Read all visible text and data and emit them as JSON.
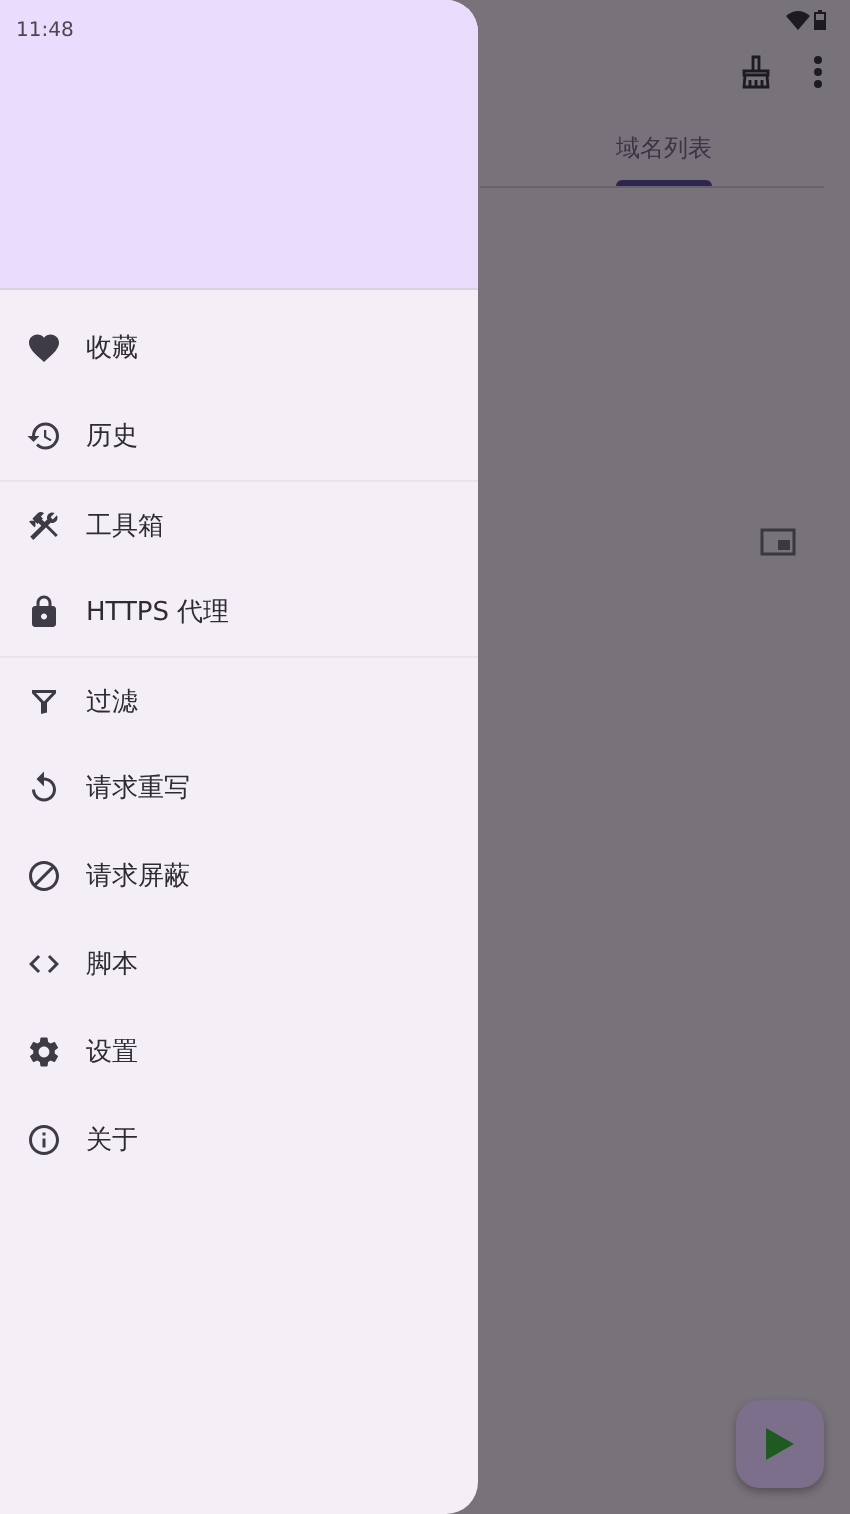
{
  "status_bar": {
    "time": "11:48"
  },
  "tabs": [
    {
      "label": "域名列表",
      "selected": true
    }
  ],
  "drawer": {
    "groups": [
      [
        {
          "kind": "heart",
          "label": "收藏"
        },
        {
          "kind": "history",
          "label": "历史"
        }
      ],
      [
        {
          "kind": "tools",
          "label": "工具箱"
        },
        {
          "kind": "lock",
          "label": "HTTPS 代理"
        }
      ],
      [
        {
          "kind": "filter",
          "label": "过滤"
        },
        {
          "kind": "rewrite",
          "label": "请求重写"
        },
        {
          "kind": "block",
          "label": "请求屏蔽"
        },
        {
          "kind": "code",
          "label": "脚本"
        },
        {
          "kind": "gear",
          "label": "设置"
        },
        {
          "kind": "info",
          "label": "关于"
        }
      ]
    ]
  }
}
